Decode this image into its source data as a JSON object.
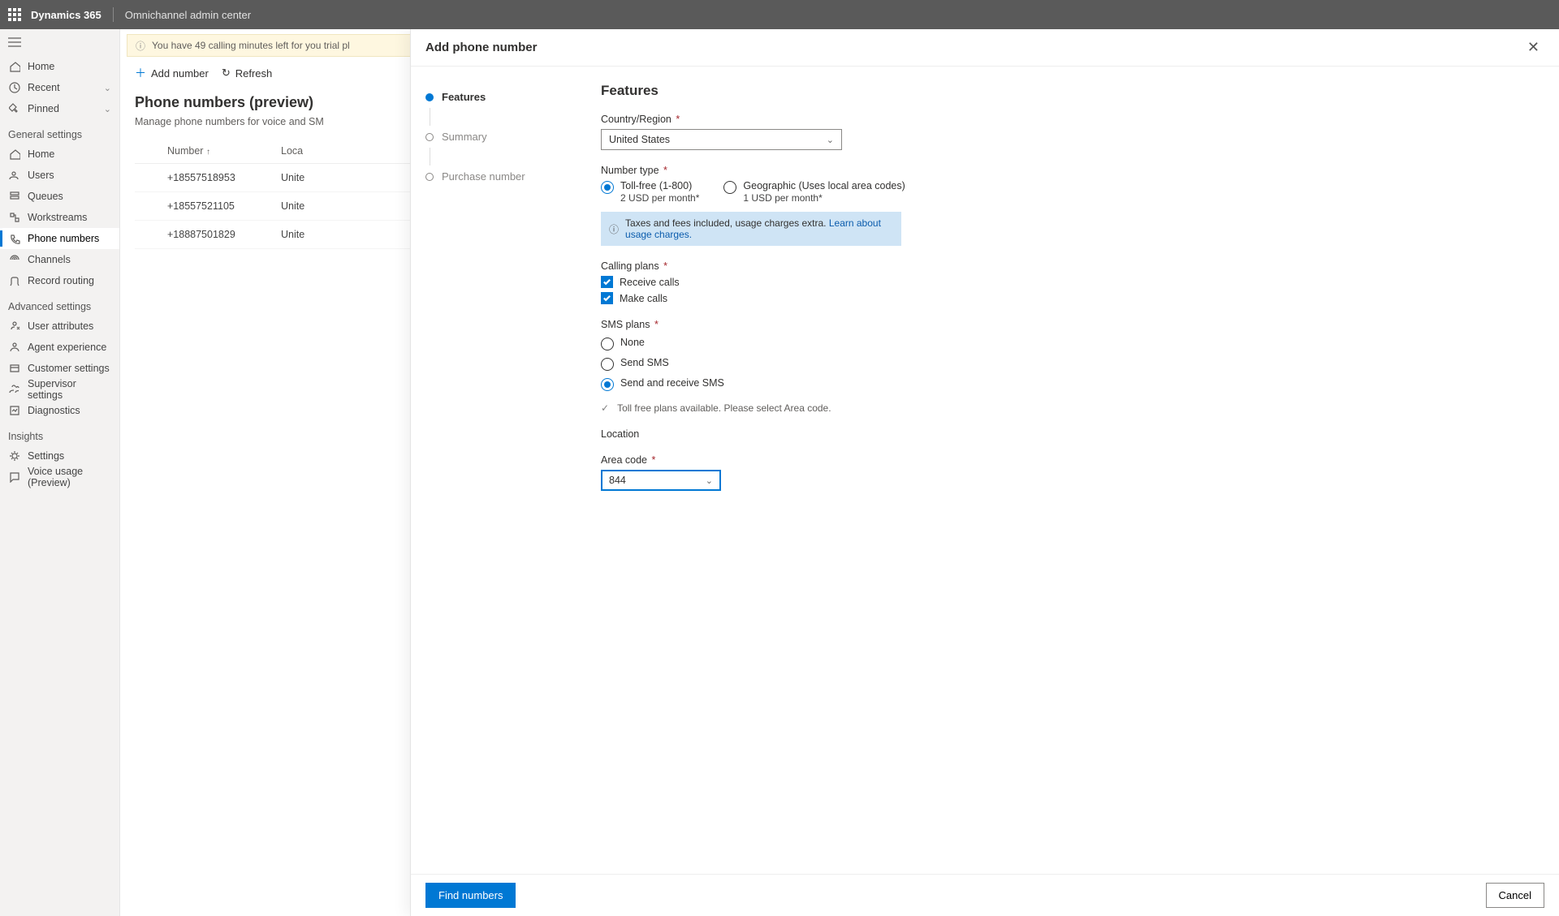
{
  "topbar": {
    "brand": "Dynamics 365",
    "app": "Omnichannel admin center"
  },
  "leftnav": {
    "quick": [
      {
        "label": "Home",
        "icon": "home"
      },
      {
        "label": "Recent",
        "icon": "clock",
        "expand": true
      },
      {
        "label": "Pinned",
        "icon": "pin",
        "expand": true
      }
    ],
    "groups": [
      {
        "title": "General settings",
        "items": [
          {
            "label": "Home",
            "icon": "home"
          },
          {
            "label": "Users",
            "icon": "users"
          },
          {
            "label": "Queues",
            "icon": "queues"
          },
          {
            "label": "Workstreams",
            "icon": "workstream"
          },
          {
            "label": "Phone numbers",
            "icon": "phone",
            "active": true
          },
          {
            "label": "Channels",
            "icon": "channels"
          },
          {
            "label": "Record routing",
            "icon": "route"
          }
        ]
      },
      {
        "title": "Advanced settings",
        "items": [
          {
            "label": "User attributes",
            "icon": "userattr"
          },
          {
            "label": "Agent experience",
            "icon": "agent"
          },
          {
            "label": "Customer settings",
            "icon": "customer"
          },
          {
            "label": "Supervisor settings",
            "icon": "supervisor"
          },
          {
            "label": "Diagnostics",
            "icon": "diag"
          }
        ]
      },
      {
        "title": "Insights",
        "items": [
          {
            "label": "Settings",
            "icon": "gear"
          },
          {
            "label": "Voice usage (Preview)",
            "icon": "voice"
          }
        ]
      }
    ]
  },
  "main": {
    "alert": {
      "text": "You have 49 calling minutes left for you trial pl"
    },
    "toolbar": {
      "add": "Add number",
      "refresh": "Refresh"
    },
    "title": "Phone numbers (preview)",
    "subtitle": "Manage phone numbers for voice and SM",
    "columns": {
      "number": "Number",
      "location": "Loca"
    },
    "rows": [
      {
        "number": "+18557518953",
        "location": "Unite"
      },
      {
        "number": "+18557521105",
        "location": "Unite"
      },
      {
        "number": "+18887501829",
        "location": "Unite"
      }
    ]
  },
  "panel": {
    "title": "Add phone number",
    "steps": [
      {
        "label": "Features",
        "active": true
      },
      {
        "label": "Summary"
      },
      {
        "label": "Purchase number"
      }
    ],
    "form": {
      "heading": "Features",
      "country_label": "Country/Region",
      "country_value": "United States",
      "numtype_label": "Number type",
      "numtype_options": [
        {
          "label": "Toll-free (1-800)",
          "sub": "2 USD per month*",
          "selected": true
        },
        {
          "label": "Geographic (Uses local area codes)",
          "sub": "1 USD per month*"
        }
      ],
      "info_text": "Taxes and fees included, usage charges extra.",
      "info_link": "Learn about usage charges.",
      "calling_label": "Calling plans",
      "calling_options": [
        {
          "label": "Receive calls",
          "checked": true
        },
        {
          "label": "Make calls",
          "checked": true
        }
      ],
      "sms_label": "SMS plans",
      "sms_options": [
        {
          "label": "None"
        },
        {
          "label": "Send SMS"
        },
        {
          "label": "Send and receive SMS",
          "selected": true
        }
      ],
      "hint": "Toll free plans available. Please select Area code.",
      "location_label": "Location",
      "areacode_label": "Area code",
      "areacode_value": "844"
    },
    "footer": {
      "primary": "Find numbers",
      "secondary": "Cancel"
    }
  }
}
